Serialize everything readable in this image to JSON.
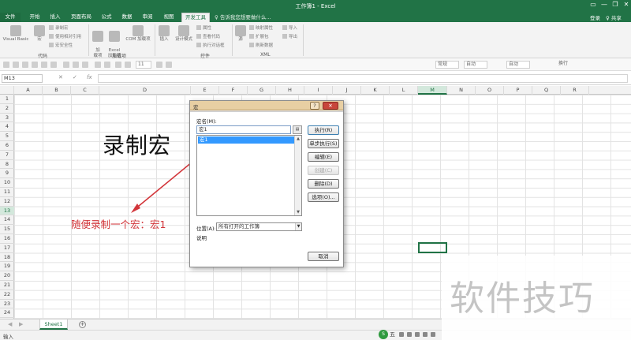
{
  "window": {
    "title": "工作簿1 - Excel",
    "controls": [
      "?",
      "▭",
      "—",
      "❐",
      "✕"
    ]
  },
  "tabs": [
    "文件",
    "开始",
    "插入",
    "页面布局",
    "公式",
    "数据",
    "审阅",
    "视图",
    "开发工具"
  ],
  "tell_me": "♀ 告诉我您想要做什么...",
  "account": {
    "login": "登录",
    "share": "♀ 共享"
  },
  "ribbon": {
    "code": {
      "label": "代码",
      "visual_basic": "Visual Basic",
      "macros": "宏",
      "record_macro": "录制宏",
      "relative_refs": "使用相对引用",
      "macro_security": "宏安全性"
    },
    "addins": {
      "label": "加载项",
      "addins": "加\n载项",
      "excel_addins": "Excel\n加载项",
      "com_addins": "COM 加载项"
    },
    "controls": {
      "label": "控件",
      "insert": "插入",
      "design_mode": "设计模式",
      "properties": "属性",
      "view_code": "查看代码",
      "run_dialog": "执行对话框"
    },
    "xml": {
      "label": "XML",
      "source": "源",
      "map_properties": "映射属性",
      "expansion_packs": "扩展包",
      "refresh_data": "刷新数据",
      "import": "导入",
      "export": "导出"
    }
  },
  "format_bar": {
    "font_size": "11",
    "number_format": "常规",
    "auto1": "自动",
    "auto2": "自动",
    "wrap": "换行"
  },
  "formula_bar": {
    "name_box": "M13",
    "cancel": "✕",
    "confirm": "✓",
    "fx": "fx",
    "value": ""
  },
  "columns": [
    "A",
    "B",
    "C",
    "D",
    "E",
    "F",
    "G",
    "H",
    "I",
    "J",
    "K",
    "L",
    "M",
    "N",
    "O",
    "P",
    "Q",
    "R"
  ],
  "rows": [
    "1",
    "2",
    "3",
    "4",
    "5",
    "6",
    "7",
    "8",
    "9",
    "10",
    "11",
    "12",
    "13",
    "14",
    "15",
    "16",
    "17",
    "18",
    "19",
    "20",
    "21",
    "22",
    "23",
    "24"
  ],
  "sheet_content": {
    "title": "录制宏",
    "annotation": "随便录制一个宏：宏1"
  },
  "dialog": {
    "title": "宏",
    "help": "?",
    "close": "✕",
    "macro_name_label": "宏名(M):",
    "macro_name_value": "宏1",
    "macros": [
      "宏1"
    ],
    "buttons": [
      "执行(R)",
      "单步执行(S)",
      "编辑(E)",
      "创建(C)",
      "删除(D)",
      "选项(O)..."
    ],
    "location_label": "位置(A):",
    "location_value": "所有打开的工作簿",
    "description_label": "说明",
    "cancel": "取消"
  },
  "sheet_tabs": [
    "Sheet1"
  ],
  "status": {
    "mode": "输入"
  },
  "ime": {
    "logo": "S",
    "mode": "五"
  },
  "watermark": "软件技巧"
}
